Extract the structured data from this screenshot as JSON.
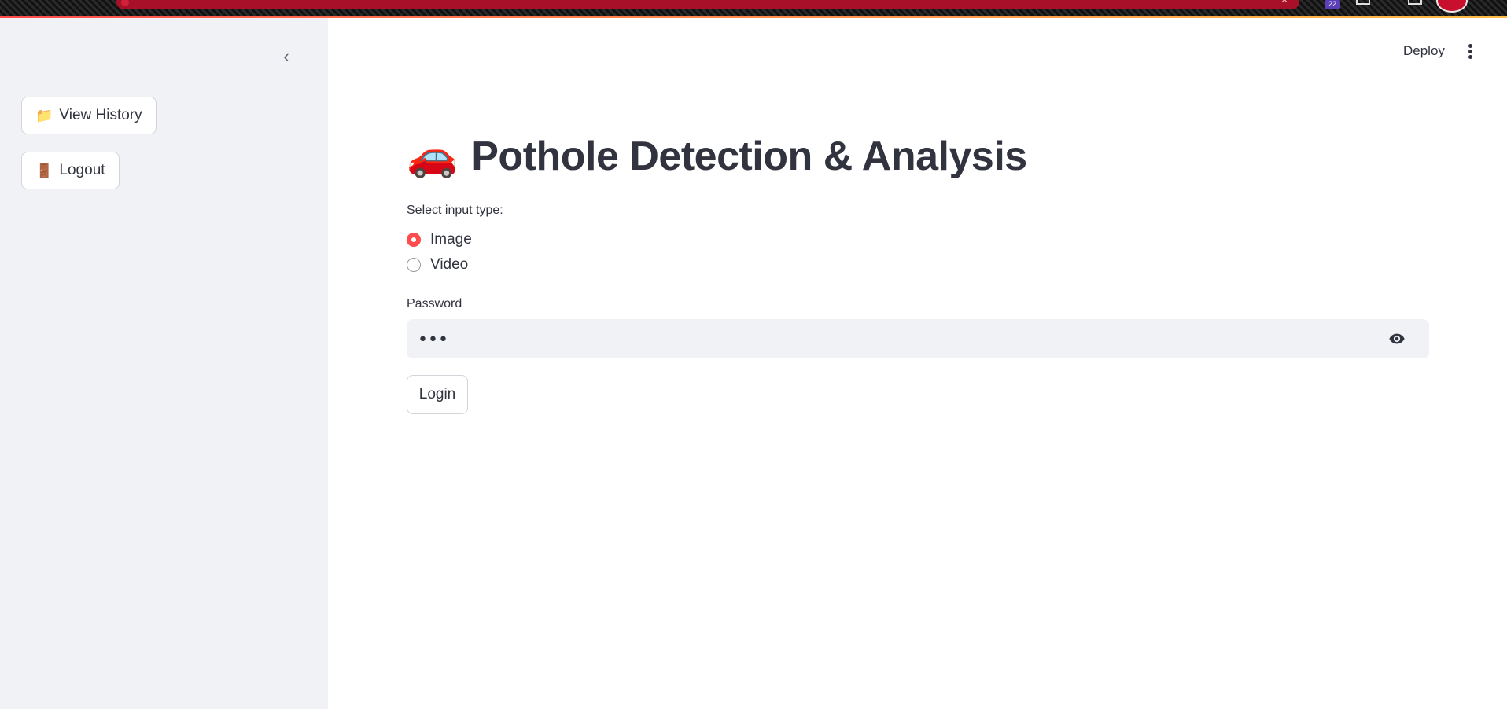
{
  "browser": {
    "extension_badge": "22"
  },
  "sidebar": {
    "collapse_glyph": "‹",
    "buttons": [
      {
        "icon": "📁",
        "icon_name": "folder-icon",
        "label": "View History"
      },
      {
        "icon": "🚪",
        "icon_name": "door-icon",
        "label": "Logout"
      }
    ]
  },
  "header": {
    "deploy_label": "Deploy",
    "menu_icon": "kebab-menu-icon"
  },
  "main": {
    "title_icon": "🚗",
    "title": "Pothole Detection & Analysis",
    "input_type": {
      "label": "Select input type:",
      "options": [
        "Image",
        "Video"
      ],
      "selected": "Image"
    },
    "password": {
      "label": "Password",
      "value": "•••",
      "toggle_icon": "eye-icon"
    },
    "login_label": "Login"
  },
  "colors": {
    "accent": "#ff4b4b",
    "sidebar_bg": "#f0f2f6",
    "text": "#31333f"
  }
}
